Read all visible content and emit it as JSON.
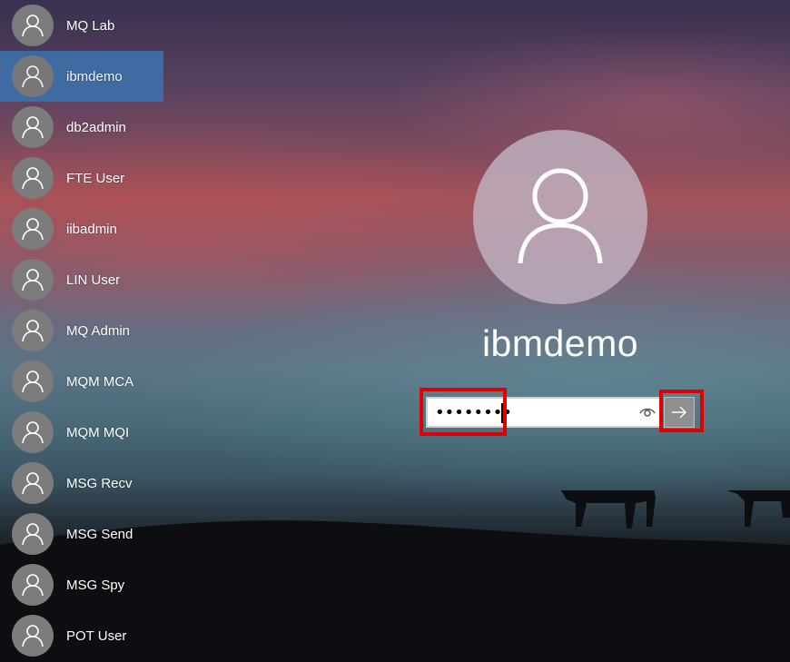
{
  "users": [
    {
      "name": "MQ Lab",
      "selected": false
    },
    {
      "name": "ibmdemo",
      "selected": true
    },
    {
      "name": "db2admin",
      "selected": false
    },
    {
      "name": "FTE User",
      "selected": false
    },
    {
      "name": "iibadmin",
      "selected": false
    },
    {
      "name": "LIN User",
      "selected": false
    },
    {
      "name": "MQ Admin",
      "selected": false
    },
    {
      "name": "MQM MCA",
      "selected": false
    },
    {
      "name": "MQM MQI",
      "selected": false
    },
    {
      "name": "MSG Recv",
      "selected": false
    },
    {
      "name": "MSG Send",
      "selected": false
    },
    {
      "name": "MSG Spy",
      "selected": false
    },
    {
      "name": "POT User",
      "selected": false
    }
  ],
  "login": {
    "current_user": "ibmdemo",
    "password_masked": "••••••••",
    "reveal_icon": "eye-icon",
    "submit_icon": "arrow-right-icon"
  },
  "highlights": [
    {
      "target": "password-input",
      "color": "#e00000"
    },
    {
      "target": "submit-button",
      "color": "#e00000"
    }
  ],
  "colors": {
    "selected_bg": "#3d6fa8",
    "avatar_bg": "#7b7b7b",
    "highlight": "#e00000"
  }
}
